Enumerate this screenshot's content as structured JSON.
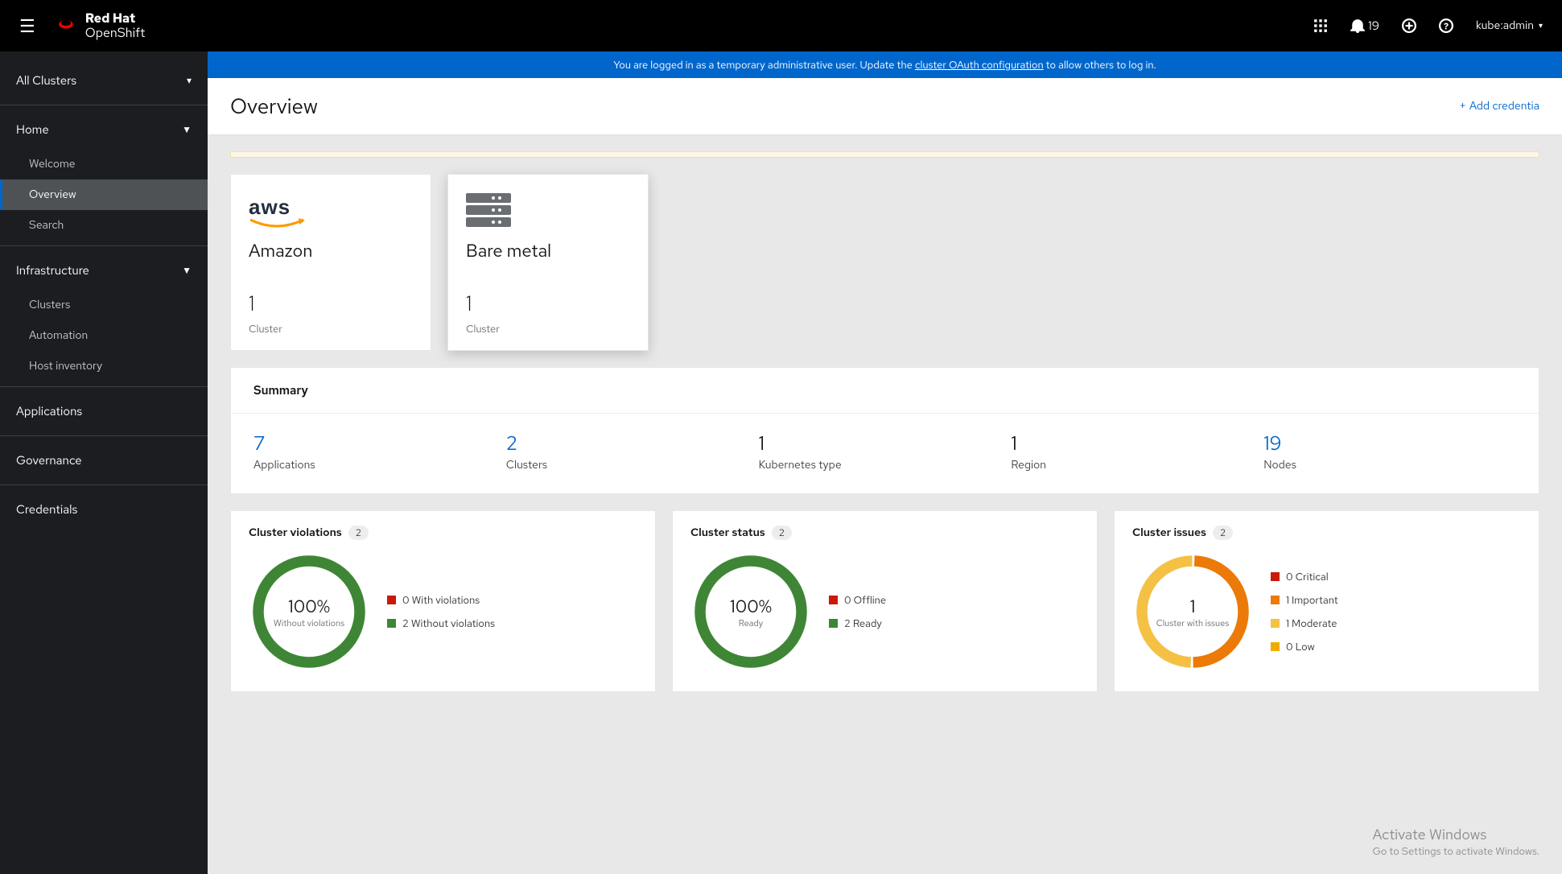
{
  "brand": {
    "line1": "Red Hat",
    "line2": "OpenShift"
  },
  "masthead": {
    "notif_count": "19",
    "user": "kube:admin"
  },
  "sidebar": {
    "cluster_switch": "All Clusters",
    "home": {
      "label": "Home",
      "items": [
        "Welcome",
        "Overview",
        "Search"
      ],
      "active": 1
    },
    "infra": {
      "label": "Infrastructure",
      "items": [
        "Clusters",
        "Automation",
        "Host inventory"
      ]
    },
    "others": [
      "Applications",
      "Governance",
      "Credentials"
    ]
  },
  "banner": {
    "pre": "You are logged in as a temporary administrative user. Update the ",
    "link": "cluster OAuth configuration",
    "post": " to allow others to log in."
  },
  "page": {
    "title": "Overview",
    "add_label": "Add credentia"
  },
  "providers": [
    {
      "kind": "aws",
      "title": "Amazon",
      "count": "1",
      "count_label": "Cluster"
    },
    {
      "kind": "bm",
      "title": "Bare metal",
      "count": "1",
      "count_label": "Cluster"
    }
  ],
  "summary": {
    "header": "Summary",
    "items": [
      {
        "value": "7",
        "label": "Applications",
        "link": true
      },
      {
        "value": "2",
        "label": "Clusters",
        "link": true
      },
      {
        "value": "1",
        "label": "Kubernetes type",
        "link": false
      },
      {
        "value": "1",
        "label": "Region",
        "link": false
      },
      {
        "value": "19",
        "label": "Nodes",
        "link": true
      }
    ]
  },
  "status_cards": {
    "violations": {
      "title": "Cluster violations",
      "badge": "2",
      "center_big": "100%",
      "center_small": "Without violations",
      "legend": [
        {
          "color": "#c9190b",
          "text": "0 With violations"
        },
        {
          "color": "#3e8635",
          "text": "2 Without violations"
        }
      ]
    },
    "status": {
      "title": "Cluster status",
      "badge": "2",
      "center_big": "100%",
      "center_small": "Ready",
      "legend": [
        {
          "color": "#c9190b",
          "text": "0 Offline"
        },
        {
          "color": "#3e8635",
          "text": "2 Ready"
        }
      ]
    },
    "issues": {
      "title": "Cluster issues",
      "badge": "2",
      "center_big": "1",
      "center_small": "Cluster with issues",
      "legend": [
        {
          "color": "#c9190b",
          "text": "0 Critical"
        },
        {
          "color": "#ec7a08",
          "text": "1 Important"
        },
        {
          "color": "#f4c145",
          "text": "1 Moderate"
        },
        {
          "color": "#f0ab00",
          "text": "0 Low"
        }
      ]
    }
  },
  "watermark": {
    "l1": "Activate Windows",
    "l2": "Go to Settings to activate Windows."
  },
  "colors": {
    "accent": "#0066cc",
    "green": "#3e8635",
    "orange": "#ec7a08",
    "red": "#c9190b",
    "yellow": "#f4c145",
    "amber": "#f0ab00"
  },
  "chart_data": [
    {
      "type": "pie",
      "title": "Cluster violations",
      "categories": [
        "With violations",
        "Without violations"
      ],
      "values": [
        0,
        2
      ]
    },
    {
      "type": "pie",
      "title": "Cluster status",
      "categories": [
        "Offline",
        "Ready"
      ],
      "values": [
        0,
        2
      ]
    },
    {
      "type": "pie",
      "title": "Cluster issues",
      "categories": [
        "Critical",
        "Important",
        "Moderate",
        "Low"
      ],
      "values": [
        0,
        1,
        1,
        0
      ]
    }
  ]
}
